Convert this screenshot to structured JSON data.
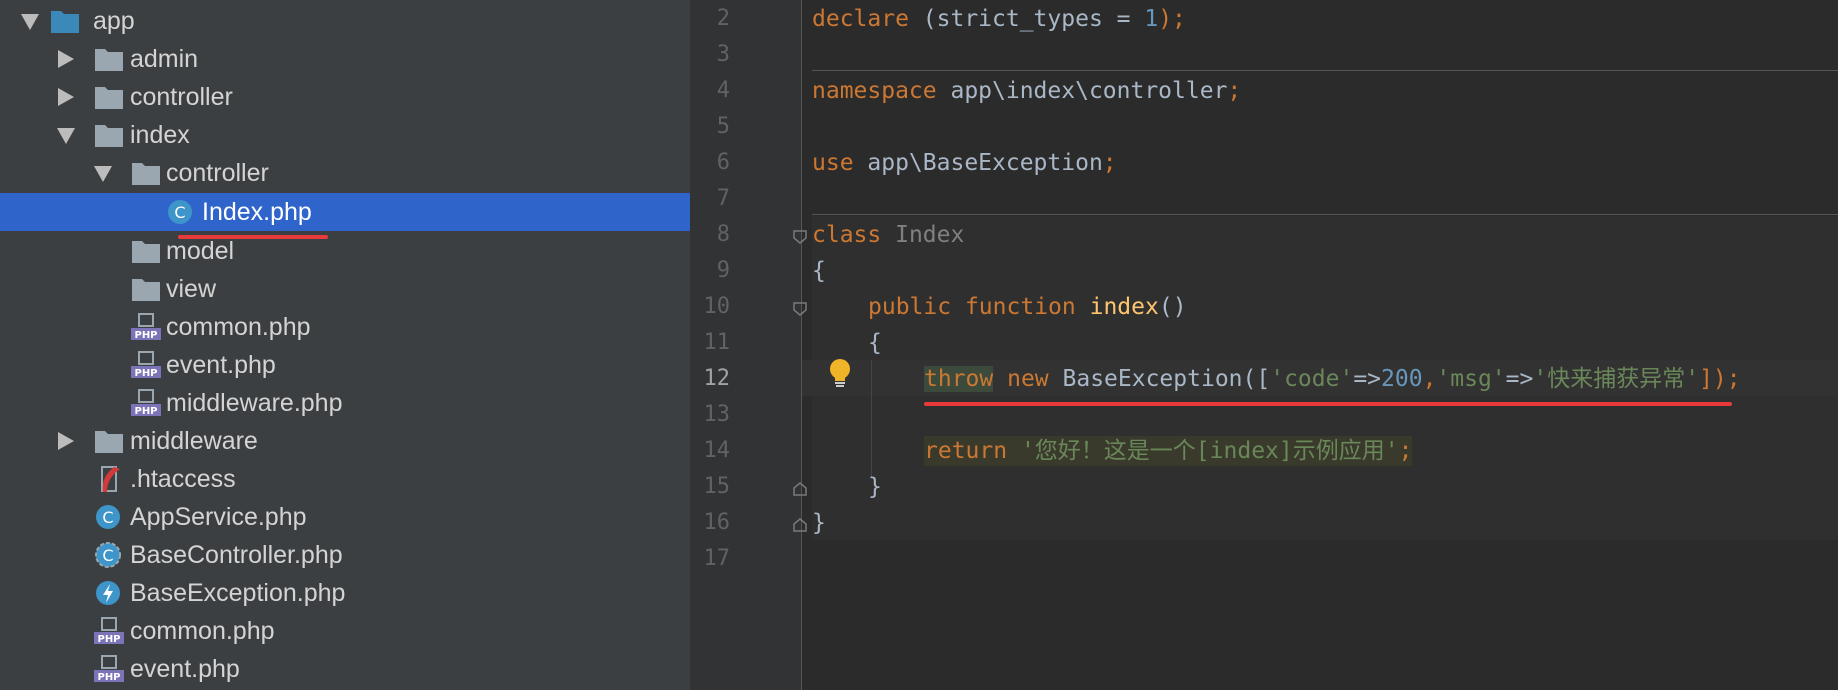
{
  "tree": {
    "items": [
      {
        "label": "app",
        "type": "folder-open",
        "selected": false
      },
      {
        "label": "admin",
        "type": "folder"
      },
      {
        "label": "controller",
        "type": "folder"
      },
      {
        "label": "index",
        "type": "folder-open"
      },
      {
        "label": "controller",
        "type": "folder-open"
      },
      {
        "label": "Index.php",
        "type": "php-class",
        "selected": true
      },
      {
        "label": "model",
        "type": "folder"
      },
      {
        "label": "view",
        "type": "folder"
      },
      {
        "label": "common.php",
        "type": "php-file"
      },
      {
        "label": "event.php",
        "type": "php-file"
      },
      {
        "label": "middleware.php",
        "type": "php-file"
      },
      {
        "label": "middleware",
        "type": "folder"
      },
      {
        "label": ".htaccess",
        "type": "htaccess"
      },
      {
        "label": "AppService.php",
        "type": "php-class"
      },
      {
        "label": "BaseController.php",
        "type": "php-abstract-class"
      },
      {
        "label": "BaseException.php",
        "type": "php-exception"
      },
      {
        "label": "common.php",
        "type": "php-file"
      },
      {
        "label": "event.php",
        "type": "php-file"
      }
    ]
  },
  "editor": {
    "line_numbers": [
      "2",
      "3",
      "4",
      "5",
      "6",
      "7",
      "8",
      "9",
      "10",
      "11",
      "12",
      "13",
      "14",
      "15",
      "16",
      "17"
    ],
    "current_line": "12",
    "lines": {
      "l2_kw": "declare",
      "l2_rest": " (strict_types = ",
      "l2_num": "1",
      "l2_end": ");",
      "l4_kw": "namespace",
      "l4_rest": " app\\index\\controller",
      "l4_end": ";",
      "l6_kw": "use",
      "l6_rest": " app\\BaseException",
      "l6_end": ";",
      "l8_kw": "class",
      "l8_name": " Index",
      "l9": "{",
      "l10_kw1": "public",
      "l10_kw2": "function",
      "l10_fn": "index",
      "l10_end": "()",
      "l11": "{",
      "l12_kw1": "throw",
      "l12_kw2": "new",
      "l12_cls": " BaseException([",
      "l12_s1": "'code'",
      "l12_op1": "=>",
      "l12_n1": "200",
      "l12_c": ",",
      "l12_s2": "'msg'",
      "l12_op2": "=>",
      "l12_s3": "'快来捕获异常'",
      "l12_end": "]);",
      "l14_kw": "return",
      "l14_str": "'您好！这是一个[index]示例应用'",
      "l14_end": ";",
      "l15": "}",
      "l16": "}"
    }
  },
  "colors": {
    "keyword": "#cc7832",
    "string": "#6a8759",
    "number": "#6897bb",
    "function": "#ffc66d",
    "selection": "#2f65ca",
    "annotation_red": "#e83a3a"
  },
  "icons": [
    "folder-icon",
    "php-file-icon",
    "php-class-icon",
    "htaccess-icon",
    "exception-icon",
    "lightbulb-icon",
    "fold-marker-icon"
  ]
}
